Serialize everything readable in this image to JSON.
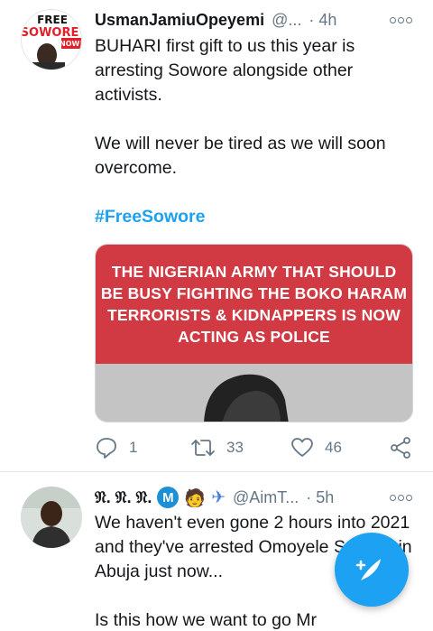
{
  "tweet1": {
    "avatar_text": {
      "line1": "FREE",
      "line2": "SOWORE",
      "line3": "NOW!"
    },
    "name": "UsmanJamiuOpeyemi",
    "handle": "@...",
    "time": "· 4h",
    "text_line1": "BUHARI first gift to us this year is arresting Sowore alongside other activists.",
    "text_line2": "We will never be tired as we will soon overcome.",
    "hashtag": "#FreeSowore",
    "media_text": "THE NIGERIAN ARMY THAT SHOULD BE BUSY FIGHTING THE BOKO HARAM TERRORISTS & KIDNAPPERS IS NOW ACTING AS POLICE",
    "reply_count": "1",
    "retweet_count": "33",
    "like_count": "46"
  },
  "tweet2": {
    "name": "𝔑. 𝔑. 𝔑.",
    "badge": "M",
    "emoji1": "🧑",
    "emoji2": "✈",
    "handle": "@AimT...",
    "time": "· 5h",
    "text_line1": "We haven't even gone 2 hours into 2021 and they've arrested Omoyele Sowore in Abuja just now...",
    "text_line2": "Is this how we want to go Mr"
  },
  "colors": {
    "accent": "#1da1f2",
    "banner": "#d23a43",
    "secondary_text": "#657786"
  },
  "icons": [
    "more-icon",
    "reply-icon",
    "retweet-icon",
    "like-icon",
    "share-icon",
    "compose-icon"
  ]
}
